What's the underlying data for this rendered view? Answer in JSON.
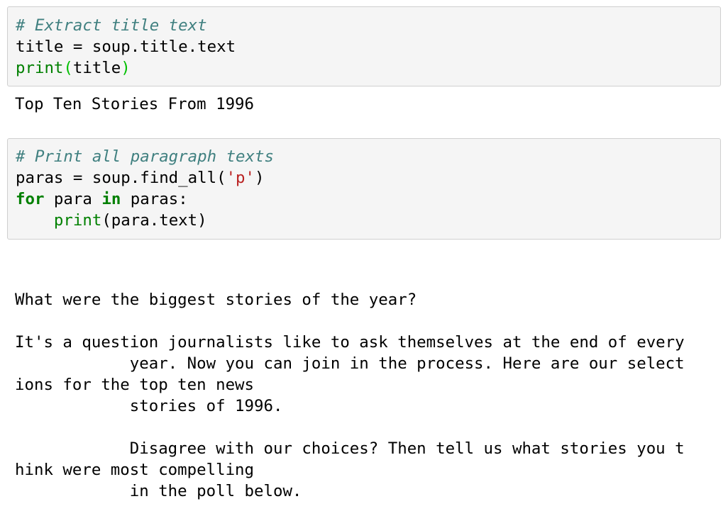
{
  "cells": [
    {
      "code": {
        "comment": "# Extract title text",
        "line2": "title = soup.title.text",
        "line3_func": "print",
        "line3_open": "(",
        "line3_arg": "title",
        "line3_close": ")"
      },
      "output": [
        "Top Ten Stories From 1996"
      ]
    },
    {
      "code": {
        "comment": "# Print all paragraph texts",
        "line2_pre": "paras = soup.find_all(",
        "line2_str": "'p'",
        "line2_post": ")",
        "line3_for": "for",
        "line3_mid": " para ",
        "line3_in": "in",
        "line3_post": " paras:",
        "line4_indent": "    ",
        "line4_func": "print",
        "line4_rest": "(para.text)"
      },
      "output": [
        "",
        "What were the biggest stories of the year?",
        "",
        "It's a question journalists like to ask themselves at the end of every",
        "            year. Now you can join in the process. Here are our select",
        "ions for the top ten news",
        "            stories of 1996.",
        "",
        "            Disagree with our choices? Then tell us what stories you t",
        "hink were most compelling",
        "            in the poll below."
      ]
    }
  ]
}
